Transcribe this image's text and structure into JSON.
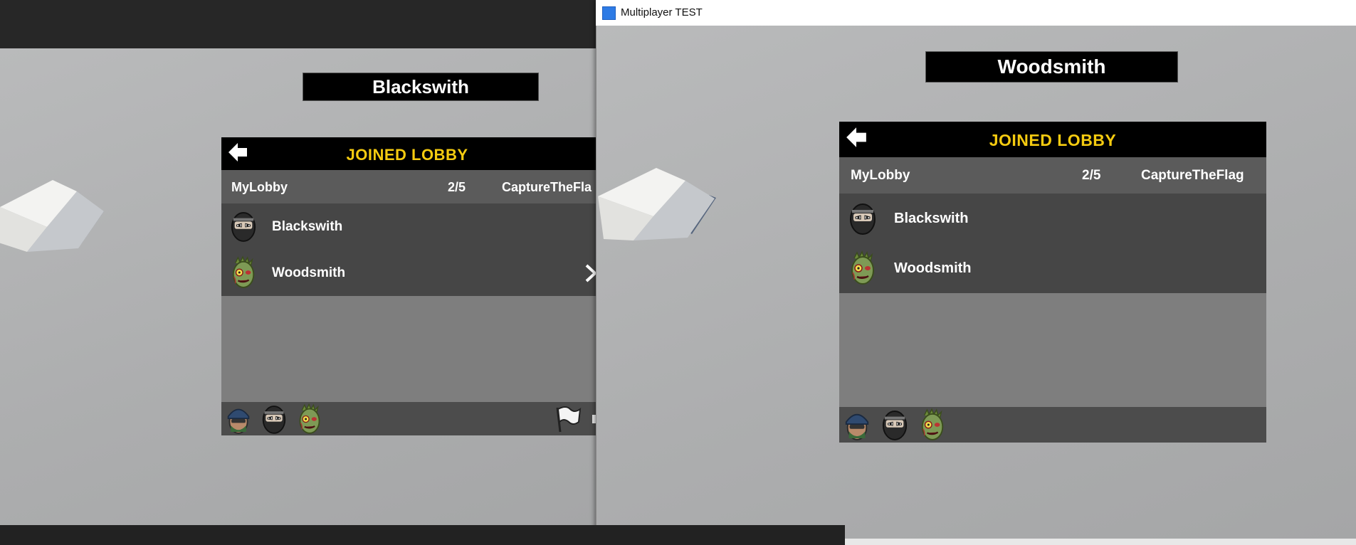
{
  "left_client": {
    "player_banner": "Blackswith",
    "lobby": {
      "header_title": "JOINED LOBBY",
      "lobby_name": "MyLobby",
      "player_count": "2/5",
      "game_mode": "CaptureTheFla",
      "players": [
        {
          "name": "Blackswith",
          "avatar": "ninja-avatar-icon"
        },
        {
          "name": "Woodsmith",
          "avatar": "zombie-avatar-icon"
        }
      ],
      "footer_characters": [
        "soldier-character-icon",
        "ninja-character-icon",
        "zombie-character-icon"
      ]
    }
  },
  "right_window": {
    "title": "Multiplayer TEST",
    "player_banner": "Woodsmith",
    "lobby": {
      "header_title": "JOINED LOBBY",
      "lobby_name": "MyLobby",
      "player_count": "2/5",
      "game_mode": "CaptureTheFlag",
      "players": [
        {
          "name": "Blackswith",
          "avatar": "ninja-avatar-icon"
        },
        {
          "name": "Woodsmith",
          "avatar": "zombie-avatar-icon"
        }
      ],
      "footer_characters": [
        "soldier-character-icon",
        "ninja-character-icon",
        "zombie-character-icon"
      ]
    }
  },
  "colors": {
    "header_title": "#f5cb10",
    "panel_header": "#000000",
    "info_bar": "#5b5b5b",
    "player_list": "#464646",
    "empty_area": "#7e7e7e",
    "footer": "#4c4c4c"
  }
}
